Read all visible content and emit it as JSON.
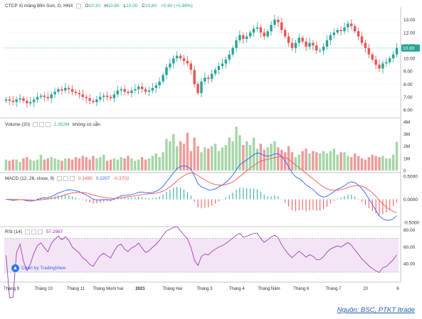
{
  "header": {
    "title": "CTCP Xi măng Bỉm Sơn, D, HNX",
    "o_label": "O",
    "o_value": "10.20",
    "h_label": "H",
    "h_value": "10.80",
    "l_label": "L",
    "l_value": "10.00",
    "c_label": "C",
    "c_value": "10.80",
    "change": "+0.60 (+5.88%)"
  },
  "volume_header": {
    "label": "Volume (20)",
    "value": "2.352M",
    "note": "không có sẵn"
  },
  "macd_header": {
    "label": "MACD (12, 26, close, 9)",
    "v1": "0.1495",
    "v2": "0.2207",
    "v3": "-0.3702"
  },
  "rsi_header": {
    "label": "RSI (14)",
    "value": "57.2987"
  },
  "watermark": "Chart by TradingView",
  "source": "Nguồn: BSC, PTKT Itrade",
  "colors": {
    "up": "#26a69a",
    "down": "#ef5350",
    "macd": "#2962ff",
    "signal": "#ff5252",
    "rsi": "#9c27b0",
    "band": "#f3e5f5"
  },
  "chart_data": [
    {
      "type": "candlestick",
      "title": "CTCP Xi măng Bỉm Sơn, D, HNX",
      "x_ticks": [
        "Tháng 9",
        "Tháng 10",
        "Tháng 11",
        "Tháng Mười hai",
        "2021",
        "Tháng Hai",
        "Tháng 3",
        "Tháng 4",
        "Tháng Năm",
        "Tháng 6",
        "Tháng 7",
        "20",
        "6"
      ],
      "y_ticks": [
        "13.00",
        "12.00",
        "11.00",
        "10.00",
        "9.00",
        "8.00",
        "7.00",
        "6.00"
      ],
      "ylim": [
        5.7,
        13.7
      ],
      "last_price_label": "10.80",
      "close": [
        6.8,
        6.7,
        6.6,
        6.8,
        6.9,
        6.7,
        6.5,
        6.6,
        6.8,
        7.0,
        7.1,
        7.0,
        6.9,
        7.2,
        7.4,
        7.6,
        7.5,
        7.7,
        7.6,
        7.4,
        7.3,
        7.2,
        7.0,
        6.9,
        6.7,
        6.6,
        6.8,
        7.0,
        7.1,
        7.0,
        6.9,
        7.2,
        7.5,
        7.6,
        7.4,
        7.3,
        7.5,
        7.6,
        7.8,
        7.6,
        7.4,
        7.5,
        7.7,
        7.9,
        8.2,
        8.7,
        9.3,
        9.6,
        10.0,
        10.2,
        10.0,
        9.8,
        9.6,
        9.1,
        8.0,
        7.3,
        8.2,
        8.5,
        8.4,
        8.8,
        9.1,
        9.4,
        9.6,
        9.9,
        10.3,
        10.8,
        11.4,
        11.8,
        11.5,
        11.7,
        12.0,
        12.3,
        12.4,
        12.0,
        11.7,
        12.1,
        12.6,
        13.0,
        12.8,
        12.2,
        11.7,
        11.2,
        10.8,
        11.2,
        11.6,
        11.3,
        10.9,
        11.2,
        11.0,
        10.6,
        10.6,
        10.9,
        11.4,
        11.8,
        12.0,
        12.2,
        12.1,
        12.4,
        12.7,
        12.5,
        12.1,
        11.7,
        11.2,
        10.8,
        10.3,
        9.9,
        9.5,
        9.2,
        9.6,
        9.7,
        10.0,
        10.3,
        10.8
      ],
      "volume_ylim": [
        0,
        4.2
      ],
      "volume_ticks": [
        "4M",
        "3M",
        "2M",
        "1M",
        "0"
      ],
      "volume": [
        0.9,
        0.8,
        0.9,
        0.9,
        0.7,
        1.0,
        1.1,
        0.9,
        0.8,
        0.9,
        1.3,
        0.9,
        1.0,
        1.1,
        1.0,
        0.9,
        0.8,
        1.0,
        1.0,
        0.9,
        1.1,
        1.0,
        1.2,
        1.1,
        0.9,
        1.2,
        1.0,
        1.1,
        1.3,
        0.8,
        0.9,
        1.0,
        0.9,
        1.1,
        1.0,
        1.2,
        1.0,
        0.8,
        0.9,
        1.1,
        0.9,
        1.0,
        1.2,
        1.4,
        1.1,
        1.5,
        2.6,
        2.4,
        3.0,
        2.0,
        2.4,
        2.2,
        3.1,
        1.6,
        2.7,
        2.0,
        1.5,
        1.9,
        1.8,
        2.0,
        2.2,
        1.6,
        1.9,
        2.1,
        2.7,
        2.4,
        3.6,
        2.9,
        2.1,
        2.4,
        2.1,
        2.7,
        1.8,
        2.2,
        1.7,
        1.9,
        2.2,
        2.4,
        1.9,
        1.7,
        1.5,
        2.0,
        1.5,
        1.1,
        1.3,
        1.6,
        1.8,
        1.4,
        1.6,
        1.5,
        1.4,
        1.6,
        1.4,
        1.6,
        1.8,
        1.3,
        1.5,
        1.5,
        1.2,
        1.1,
        1.4,
        1.2,
        1.0,
        0.9,
        1.1,
        1.3,
        1.2,
        1.1,
        1.2,
        1.0,
        1.0,
        1.3,
        2.35
      ],
      "macd_ylim": [
        -0.58,
        0.55
      ],
      "macd_ticks": [
        "0.5000",
        "0.0000",
        "-0.5000"
      ],
      "rsi_ylim": [
        20,
        83
      ],
      "rsi_ticks": [
        "80.00",
        "60.00",
        "40.00"
      ],
      "rsi_band": [
        30,
        70
      ]
    }
  ]
}
